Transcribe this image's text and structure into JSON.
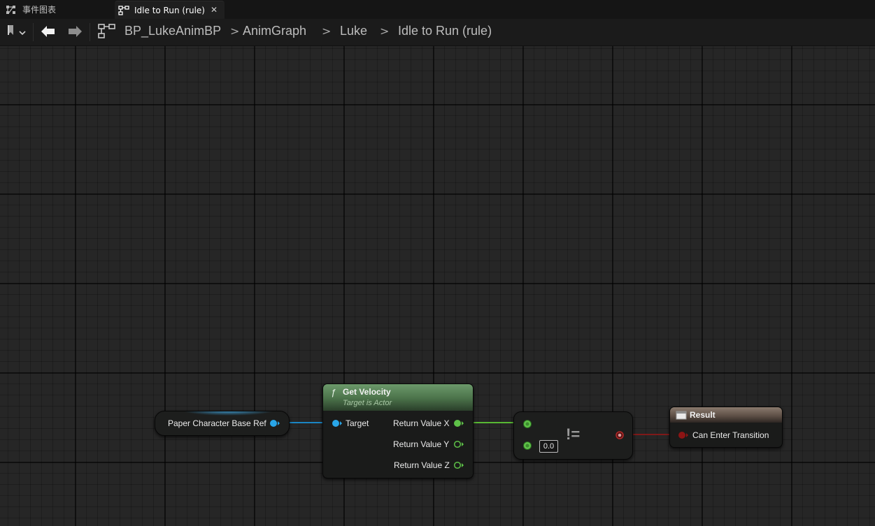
{
  "tabs": [
    {
      "label": "事件图表",
      "icon": "event-graph-icon",
      "active": false
    },
    {
      "label": "Idle to Run (rule)",
      "icon": "transition-rule-icon",
      "active": true,
      "close": "✕"
    }
  ],
  "toolbar": {
    "bookmark_icon": "bookmark-icon",
    "back_icon": "arrow-left-icon",
    "forward_icon": "arrow-right-icon",
    "graph_icon": "graph-tree-icon",
    "breadcrumbs": [
      "BP_LukeAnimBP",
      "AnimGraph",
      "Luke",
      "Idle to Run (rule)"
    ],
    "separator": ">"
  },
  "nodes": {
    "variable": {
      "label": "Paper Character Base Ref",
      "pin_color": "#29a6e8"
    },
    "get_velocity": {
      "title": "Get Velocity",
      "subtitle": "Target is Actor",
      "function_glyph": "ƒ",
      "input_pin": "Target",
      "outputs": [
        "Return Value X",
        "Return Value Y",
        "Return Value Z"
      ],
      "header_color": "#3f6a40"
    },
    "not_equal": {
      "operator": "!=",
      "default_value": "0.0",
      "pin_color": "#5ec248"
    },
    "result": {
      "title": "Result",
      "input_pin": "Can Enter Transition",
      "pin_color": "#8c1414"
    }
  },
  "colors": {
    "object_wire": "#1b86c4",
    "float_wire": "#58b833",
    "bool_wire": "#7e1919",
    "grid_background": "#262626"
  }
}
